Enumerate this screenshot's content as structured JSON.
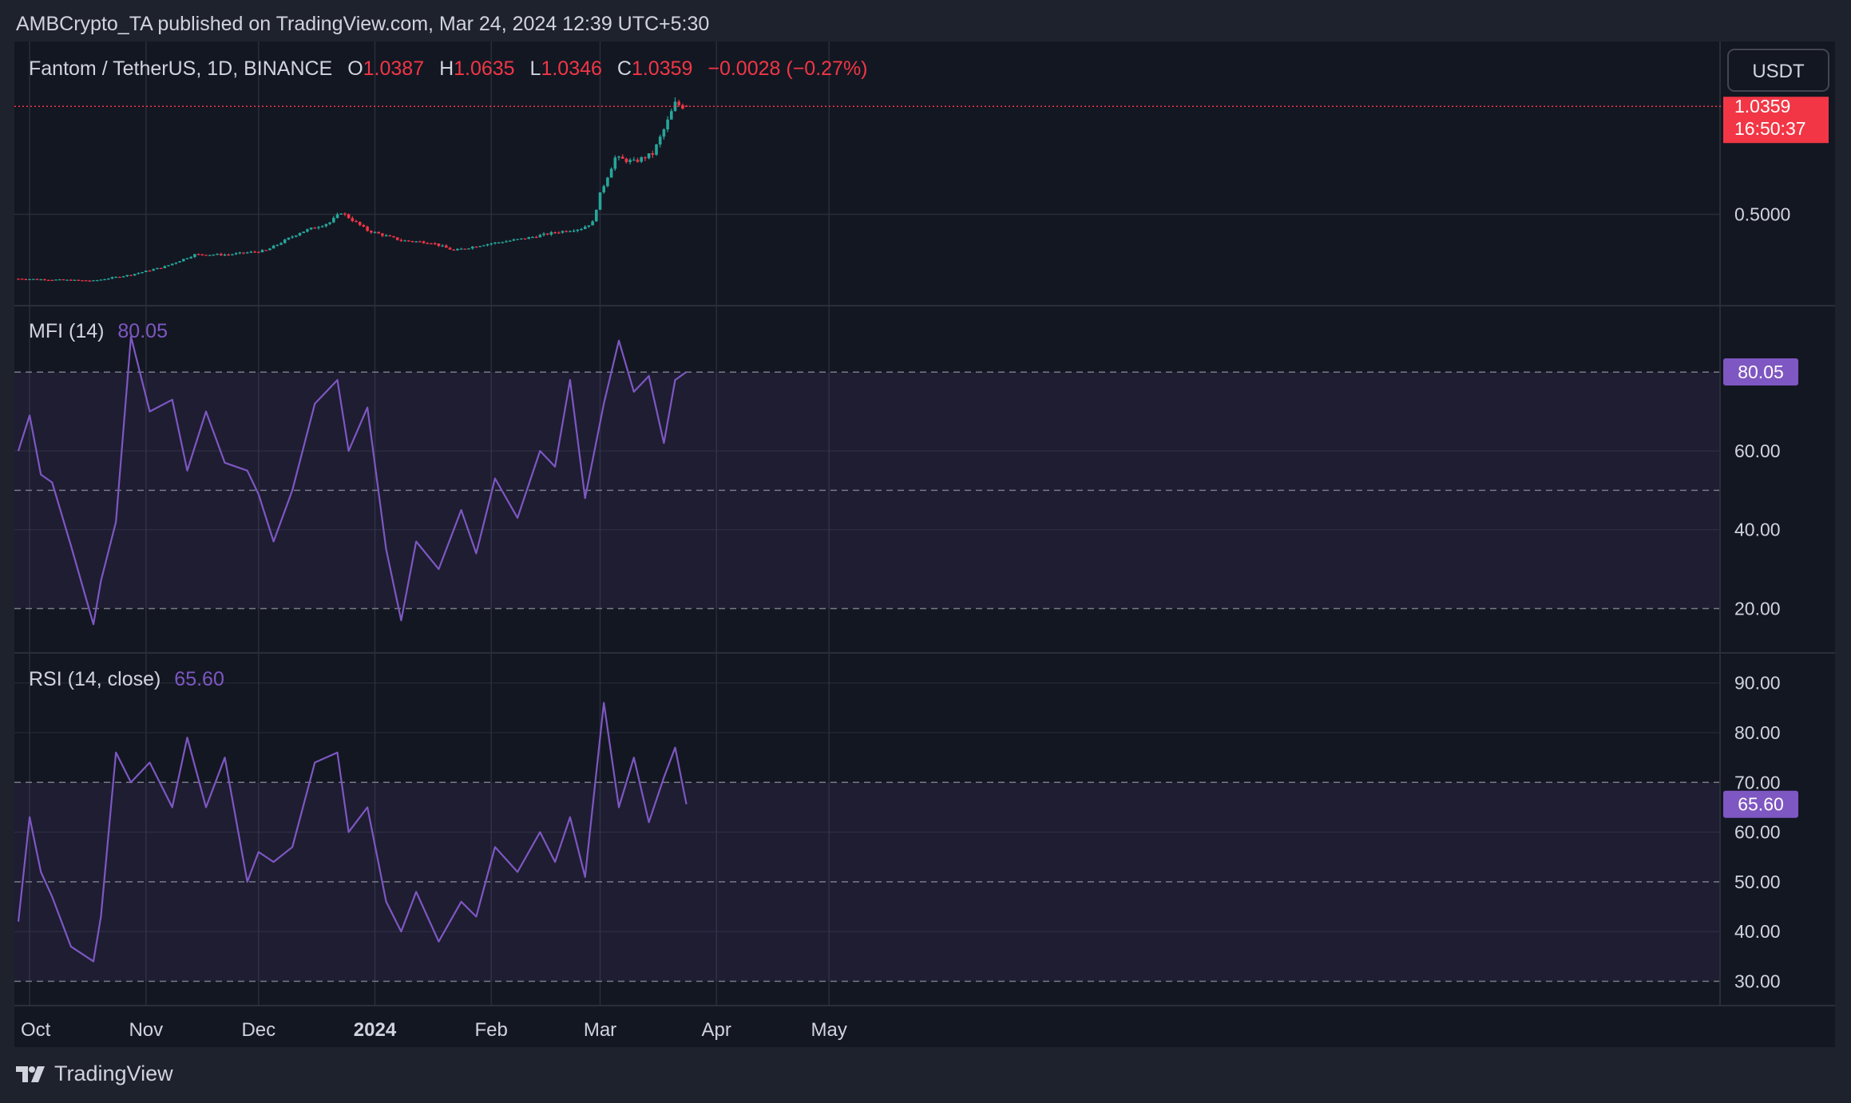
{
  "header": {
    "published_text": "AMBCrypto_TA published on TradingView.com, Mar 24, 2024 12:39 UTC+5:30"
  },
  "legend": {
    "symbol": "Fantom / TetherUS, 1D, BINANCE",
    "o_label": "O",
    "o_value": "1.0387",
    "h_label": "H",
    "h_value": "1.0635",
    "l_label": "L",
    "l_value": "1.0346",
    "c_label": "C",
    "c_value": "1.0359",
    "change": "−0.0028 (−0.27%)"
  },
  "currency_button": "USDT",
  "price_tag": {
    "price": "1.0359",
    "countdown": "16:50:37"
  },
  "mfi": {
    "label": "MFI (14)",
    "value": "80.05"
  },
  "rsi": {
    "label": "RSI (14, close)",
    "value": "65.60"
  },
  "footer": {
    "brand": "TradingView"
  },
  "colors": {
    "up": "#26a69a",
    "down": "#f23645",
    "indicator": "#7e57c2",
    "background": "#131722",
    "page": "#1e222d",
    "grid": "#2a2e39"
  },
  "chart_data": [
    {
      "type": "candlestick",
      "title": "Fantom / TetherUS, 1D, BINANCE",
      "ylim": [
        0.09,
        1.12
      ],
      "y_ticks": [
        "0.5000"
      ],
      "x_ticks": [
        "Oct",
        "Nov",
        "Dec",
        "2024",
        "Feb",
        "Mar",
        "Apr",
        "May"
      ],
      "close_series": {
        "dates": [
          "2023-09-28",
          "2023-10-08",
          "2023-10-18",
          "2023-10-28",
          "2023-11-06",
          "2023-11-14",
          "2023-11-23",
          "2023-12-03",
          "2023-12-12",
          "2023-12-20",
          "2023-12-23",
          "2023-12-30",
          "2024-01-08",
          "2024-01-16",
          "2024-01-22",
          "2024-01-30",
          "2024-02-10",
          "2024-02-18",
          "2024-02-25",
          "2024-02-28",
          "2024-03-01",
          "2024-03-05",
          "2024-03-10",
          "2024-03-15",
          "2024-03-18",
          "2024-03-21",
          "2024-03-23"
        ],
        "values": [
          0.18,
          0.175,
          0.17,
          0.2,
          0.24,
          0.3,
          0.3,
          0.32,
          0.41,
          0.46,
          0.51,
          0.42,
          0.37,
          0.36,
          0.32,
          0.35,
          0.38,
          0.41,
          0.43,
          0.46,
          0.6,
          0.78,
          0.76,
          0.8,
          0.92,
          1.05,
          1.0359
        ]
      },
      "last_price": 1.0359
    },
    {
      "type": "line",
      "title": "MFI (14)",
      "ylim": [
        12,
        93
      ],
      "y_ticks": [
        "80.05",
        "60.00",
        "40.00",
        "20.00"
      ],
      "bands": [
        80,
        50,
        20
      ],
      "dates": [
        "2023-09-28",
        "2023-10-01",
        "2023-10-04",
        "2023-10-07",
        "2023-10-12",
        "2023-10-18",
        "2023-10-20",
        "2023-10-24",
        "2023-10-28",
        "2023-11-02",
        "2023-11-08",
        "2023-11-12",
        "2023-11-17",
        "2023-11-22",
        "2023-11-28",
        "2023-12-01",
        "2023-12-05",
        "2023-12-10",
        "2023-12-16",
        "2023-12-22",
        "2023-12-25",
        "2023-12-30",
        "2024-01-04",
        "2024-01-08",
        "2024-01-12",
        "2024-01-18",
        "2024-01-24",
        "2024-01-28",
        "2024-02-02",
        "2024-02-08",
        "2024-02-14",
        "2024-02-18",
        "2024-02-22",
        "2024-02-26",
        "2024-03-02",
        "2024-03-06",
        "2024-03-10",
        "2024-03-14",
        "2024-03-18",
        "2024-03-21",
        "2024-03-24"
      ],
      "values": [
        60,
        69,
        54,
        52,
        36,
        16,
        27,
        42,
        89,
        70,
        73,
        55,
        70,
        57,
        55,
        49,
        37,
        50,
        72,
        78,
        60,
        71,
        35,
        17,
        37,
        30,
        45,
        34,
        53,
        43,
        60,
        56,
        78,
        48,
        72,
        88,
        75,
        79,
        62,
        78,
        80.05
      ]
    },
    {
      "type": "line",
      "title": "RSI (14, close)",
      "ylim": [
        28,
        93
      ],
      "y_ticks": [
        "90.00",
        "80.00",
        "70.00",
        "65.60",
        "60.00",
        "50.00",
        "40.00",
        "30.00"
      ],
      "bands": [
        70,
        50,
        30
      ],
      "dates": [
        "2023-09-28",
        "2023-10-01",
        "2023-10-04",
        "2023-10-07",
        "2023-10-12",
        "2023-10-18",
        "2023-10-20",
        "2023-10-24",
        "2023-10-28",
        "2023-11-02",
        "2023-11-08",
        "2023-11-12",
        "2023-11-17",
        "2023-11-22",
        "2023-11-28",
        "2023-12-01",
        "2023-12-05",
        "2023-12-10",
        "2023-12-16",
        "2023-12-22",
        "2023-12-25",
        "2023-12-30",
        "2024-01-04",
        "2024-01-08",
        "2024-01-12",
        "2024-01-18",
        "2024-01-24",
        "2024-01-28",
        "2024-02-02",
        "2024-02-08",
        "2024-02-14",
        "2024-02-18",
        "2024-02-22",
        "2024-02-26",
        "2024-03-02",
        "2024-03-06",
        "2024-03-10",
        "2024-03-14",
        "2024-03-18",
        "2024-03-21",
        "2024-03-24"
      ],
      "values": [
        42,
        63,
        52,
        47,
        37,
        34,
        43,
        76,
        70,
        74,
        65,
        79,
        65,
        75,
        50,
        56,
        54,
        57,
        74,
        76,
        60,
        65,
        46,
        40,
        48,
        38,
        46,
        43,
        57,
        52,
        60,
        54,
        63,
        51,
        86,
        65,
        75,
        62,
        71,
        77,
        65.6
      ]
    }
  ]
}
